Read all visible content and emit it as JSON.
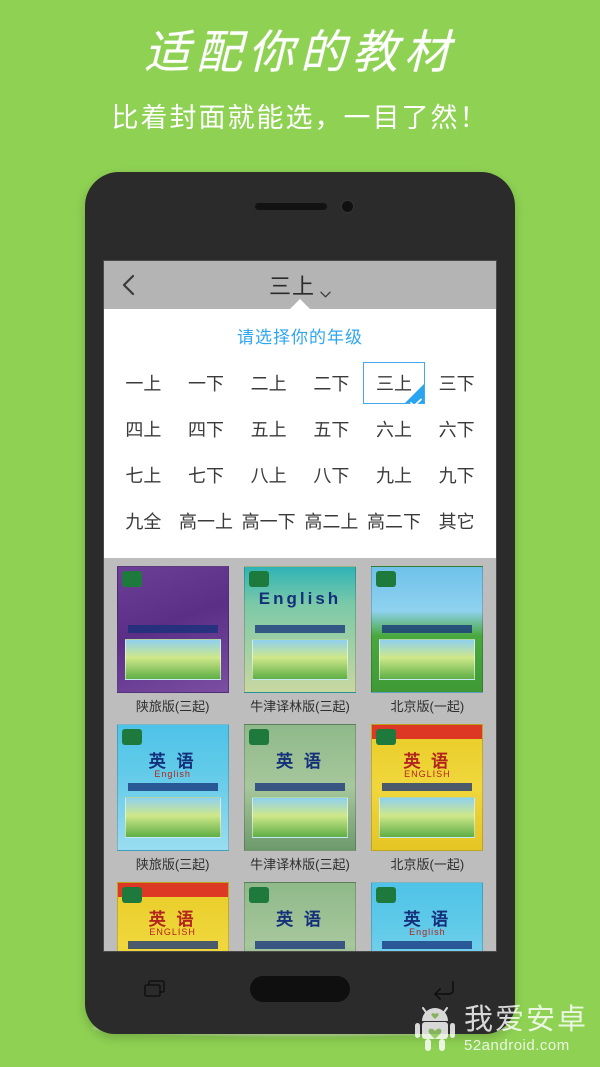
{
  "promo": {
    "title": "适配你的教材",
    "subtitle": "比着封面就能选，一目了然！"
  },
  "colors": {
    "background_green": "#8ed153",
    "appbar_grey": "#b4b4b4",
    "content_grey": "#bdbdbd",
    "accent_blue": "#2fa6f2",
    "selected_border": "#44a8ef",
    "phone_body": "#2b2b2b"
  },
  "phone": {
    "appbar": {
      "back_icon": "chevron-left-icon",
      "title": "三上",
      "caret_icon": "chevron-down-icon"
    },
    "dropdown": {
      "heading": "请选择你的年级",
      "selected": "三上",
      "check_icon": "check-icon",
      "grades": [
        "一上",
        "一下",
        "二上",
        "二下",
        "三上",
        "三下",
        "四上",
        "四下",
        "五上",
        "五下",
        "六上",
        "六下",
        "七上",
        "七下",
        "八上",
        "八下",
        "九上",
        "九下",
        "九全",
        "高一上",
        "高一下",
        "高二上",
        "高二下",
        "其它"
      ]
    },
    "booklist": {
      "rows": [
        {
          "items": [
            {
              "label": "陕旅版(三起)",
              "cover": "cv-purple",
              "title": "",
              "sub": ""
            },
            {
              "label": "牛津译林版(三起)",
              "cover": "cv-teal",
              "title": "English",
              "sub": ""
            },
            {
              "label": "北京版(一起)",
              "cover": "cv-scene",
              "title": "",
              "sub": ""
            }
          ]
        },
        {
          "items": [
            {
              "label": "陕旅版(三起)",
              "cover": "cv-blue",
              "title": "英 语",
              "sub": "English"
            },
            {
              "label": "牛津译林版(三起)",
              "cover": "cv-green",
              "title": "英 语",
              "sub": ""
            },
            {
              "label": "北京版(一起)",
              "cover": "cv-yellow",
              "title": "英 语",
              "sub": "ENGLISH"
            }
          ]
        },
        {
          "items": [
            {
              "label": "",
              "cover": "cv-yellow",
              "title": "英 语",
              "sub": "ENGLISH"
            },
            {
              "label": "",
              "cover": "cv-green",
              "title": "英 语",
              "sub": ""
            },
            {
              "label": "",
              "cover": "cv-blue",
              "title": "英 语",
              "sub": "English"
            }
          ]
        }
      ]
    },
    "navbar": {
      "recent_icon": "recent-apps-icon",
      "home_button": "home-button",
      "back_icon": "back-arrow-icon"
    }
  },
  "watermark": {
    "robot_icon": "android-robot-icon",
    "name": "我爱安卓",
    "url": "52android.com"
  }
}
